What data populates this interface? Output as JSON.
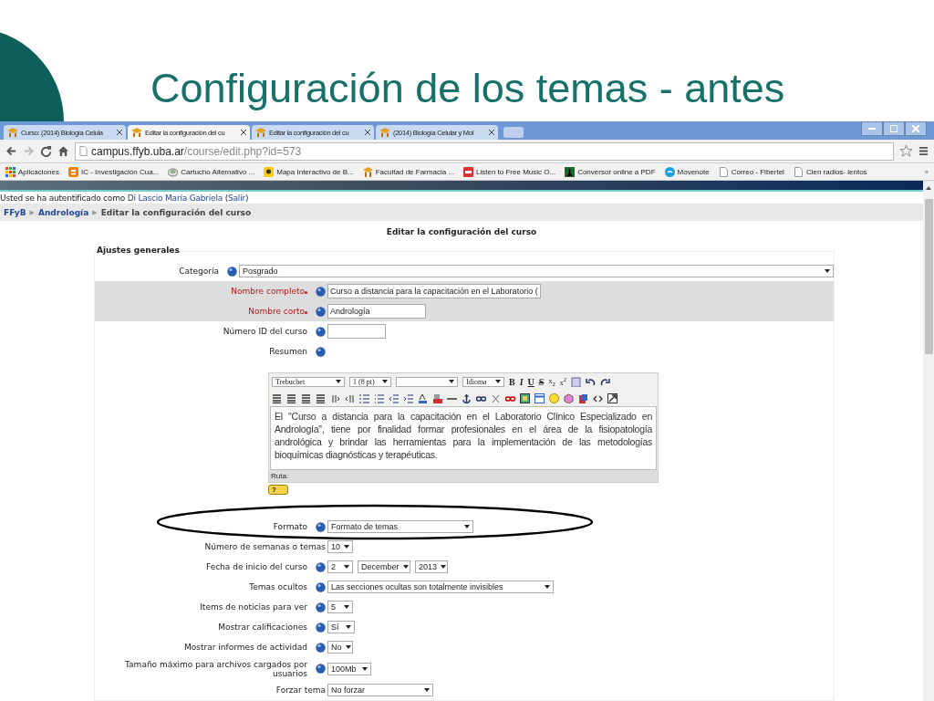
{
  "slide": {
    "title": "Configuración de los temas - antes"
  },
  "browser": {
    "tabs": [
      {
        "label": "Curso: (2014) Biología Celula",
        "selected": false
      },
      {
        "label": "Editar la configuración del cu",
        "selected": true
      },
      {
        "label": "Editar la configuración del cu",
        "selected": false
      },
      {
        "label": "(2014) Biología Celular y Mol",
        "selected": false
      }
    ],
    "url_host": "campus.ffyb.uba.ar",
    "url_path": "/course/edit.php?id=573",
    "bookmarks": [
      {
        "label": "Aplicaciones",
        "kind": "apps"
      },
      {
        "label": "IC - Investigación Cua...",
        "kind": "blog"
      },
      {
        "label": "Cartucho Alternativo ...",
        "kind": "disc"
      },
      {
        "label": "Mapa Interactivo de B...",
        "kind": "pin"
      },
      {
        "label": "Facultad de Farmacia ...",
        "kind": "cap"
      },
      {
        "label": "Listen to Free Music O...",
        "kind": "music"
      },
      {
        "label": "Conversor online a PDF",
        "kind": "figure"
      },
      {
        "label": "Movenote",
        "kind": "wave"
      },
      {
        "label": "Correo - Fibertel",
        "kind": "page"
      },
      {
        "label": "Cien radios- lentos",
        "kind": "page"
      }
    ],
    "overflow": "»"
  },
  "login": {
    "before": "Usted se ha autentificado como ",
    "user": "Di Lascio María Gabriela",
    "between": " (",
    "logout": "Salir",
    "after": ")"
  },
  "breadcrumb": [
    {
      "label": "FFyB",
      "kind": "link"
    },
    {
      "label": "▶",
      "kind": "sep"
    },
    {
      "label": "Andrología",
      "kind": "link"
    },
    {
      "label": "▶",
      "kind": "sep"
    },
    {
      "label": "Editar la configuración del curso",
      "kind": "current"
    }
  ],
  "form": {
    "heading": "Editar la configuración del curso",
    "legend": "Ajustes generales",
    "fields": [
      {
        "label": "Categoría",
        "kind": "select",
        "value": "Posgrado",
        "required": false,
        "help": true
      },
      {
        "label": "Nombre completo",
        "kind": "text",
        "value": "Curso a distancia para la capacitación en el Laboratorio (",
        "required": true,
        "help": true
      },
      {
        "label": "Nombre corto",
        "kind": "text",
        "value": "Andrología",
        "required": true,
        "help": true
      },
      {
        "label": "Número ID del curso",
        "kind": "text",
        "required": false,
        "help": true
      },
      {
        "label": "Resumen",
        "kind": "label",
        "required": false,
        "help": true
      },
      {
        "kind": "editor",
        "font": "Trebuchet",
        "size": "1 (8 pt)",
        "language": "Idioma",
        "format_buttons": [
          "B",
          "I",
          "U",
          "S"
        ],
        "script_buttons": [
          "x$_{2}$",
          "x$^{2}$"
        ],
        "text": "El \"Curso a distancia para la capacitación en el Laboratorio Clínico Especializado en Andrología\", tiene por finalidad formar profesionales en el área de la fisiopatología andrológica y brindar las herramientas para la implementación de las metodologías bioquímicas diagnósticas y terapéuticas.",
        "path_label": "Ruta:",
        "help_badge": "?"
      },
      {
        "label": "Formato",
        "kind": "select",
        "value": "Formato de temas",
        "required": false,
        "help": true
      },
      {
        "label": "Número de semanas o temas",
        "kind": "select",
        "value": "10",
        "required": false,
        "help": false
      },
      {
        "label": "Fecha de inicio del curso",
        "kind": "date",
        "values": [
          "2",
          "December",
          "2013"
        ],
        "required": false,
        "help": true
      },
      {
        "label": "Temas ocultos",
        "kind": "select",
        "value": "Las secciones ocultas son totalmente invisibles",
        "required": false,
        "help": true
      },
      {
        "label": "Items de noticias para ver",
        "kind": "select",
        "value": "5",
        "required": false,
        "help": true
      },
      {
        "label": "Mostrar calificaciones",
        "kind": "select",
        "value": "Sí",
        "required": false,
        "help": true
      },
      {
        "label": "Mostrar informes de actividad",
        "kind": "select",
        "value": "No",
        "required": false,
        "help": true
      },
      {
        "label": "Tamaño máximo para archivos cargados por usuarios",
        "kind": "select",
        "value": "100Mb",
        "required": false,
        "help": true
      },
      {
        "label": "Forzar tema",
        "kind": "select",
        "value": "No forzar",
        "required": false,
        "help": false
      }
    ]
  },
  "annotation": {
    "kind": "ellipse"
  }
}
